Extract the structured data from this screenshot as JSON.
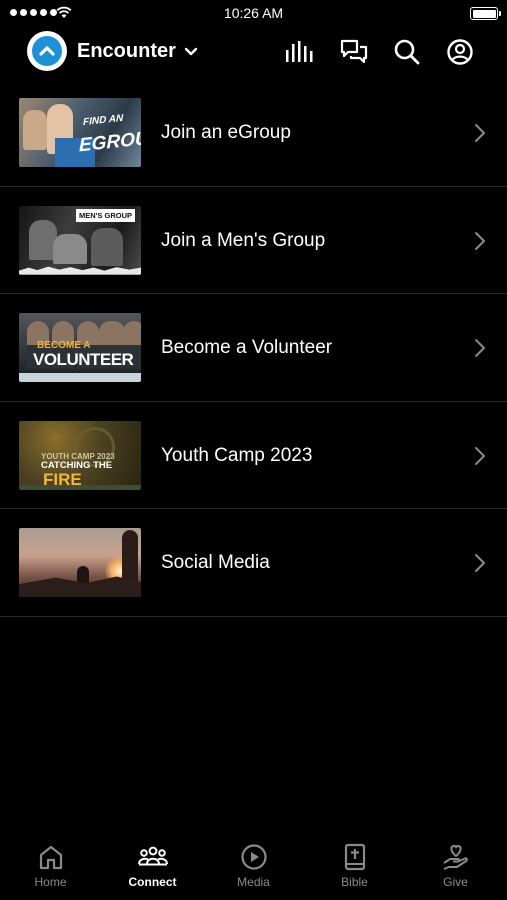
{
  "status_bar": {
    "time": "10:26 AM"
  },
  "header": {
    "app_name": "Encounter",
    "icons": [
      "stats-icon",
      "messages-icon",
      "search-icon",
      "profile-icon"
    ]
  },
  "items": [
    {
      "label": "Join an eGroup",
      "thumbnail": {
        "line1": "FIND AN",
        "line2": "EGROUP"
      }
    },
    {
      "label": "Join a Men's Group",
      "thumbnail": {
        "banner": "MEN'S GROUP"
      }
    },
    {
      "label": "Become a Volunteer",
      "thumbnail": {
        "line1": "BECOME A",
        "line2": "VOLUNTEER"
      }
    },
    {
      "label": "Youth Camp 2023",
      "thumbnail": {
        "line1": "YOUTH CAMP 2023",
        "line2": "CATCHING THE",
        "line3": "FIRE"
      }
    },
    {
      "label": "Social Media"
    }
  ],
  "tabs": [
    {
      "label": "Home",
      "icon": "home-icon",
      "active": false
    },
    {
      "label": "Connect",
      "icon": "people-icon",
      "active": true
    },
    {
      "label": "Media",
      "icon": "play-icon",
      "active": false
    },
    {
      "label": "Bible",
      "icon": "bible-icon",
      "active": false
    },
    {
      "label": "Give",
      "icon": "give-icon",
      "active": false
    }
  ],
  "colors": {
    "background": "#000000",
    "logo_accent": "#1e90d6",
    "divider": "#2a2a2a",
    "tab_inactive": "#8a8a8a",
    "tab_active": "#ffffff"
  }
}
